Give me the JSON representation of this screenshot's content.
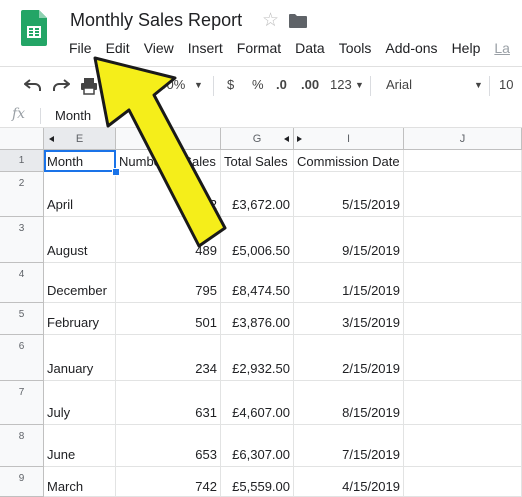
{
  "app": {
    "title": "Monthly Sales Report",
    "menu": [
      "File",
      "Edit",
      "View",
      "Insert",
      "Format",
      "Data",
      "Tools",
      "Add-ons",
      "Help",
      "La"
    ]
  },
  "toolbar": {
    "zoom": "100%",
    "currency": "$",
    "percent": "%",
    "decrease_decimals": ".0",
    "increase_decimals": ".00",
    "more_formats": "123",
    "font": "Arial",
    "font_size": "10"
  },
  "formula_bar": {
    "fx": "fx",
    "value": "Month"
  },
  "grid": {
    "columns": [
      "E",
      "F",
      "G",
      "I",
      "J"
    ],
    "row_numbers": [
      "1",
      "2",
      "3",
      "4",
      "5",
      "6",
      "7",
      "8",
      "9"
    ],
    "rows": [
      [
        "Month",
        "Number of Sales",
        "Total Sales",
        "Commission Date"
      ],
      [
        "April",
        "532",
        "£3,672.00",
        "5/15/2019"
      ],
      [
        "August",
        "489",
        "£5,006.50",
        "9/15/2019"
      ],
      [
        "December",
        "795",
        "£8,474.50",
        "1/15/2019"
      ],
      [
        "February",
        "501",
        "£3,876.00",
        "3/15/2019"
      ],
      [
        "January",
        "234",
        "£2,932.50",
        "2/15/2019"
      ],
      [
        "July",
        "631",
        "£4,607.00",
        "8/15/2019"
      ],
      [
        "June",
        "653",
        "£6,307.00",
        "7/15/2019"
      ],
      [
        "March",
        "742",
        "£5,559.00",
        "4/15/2019"
      ]
    ]
  },
  "colors": {
    "sheets_green": "#23a566",
    "selection_blue": "#1a73e8",
    "annotation_arrow": "#f5ee1a"
  }
}
